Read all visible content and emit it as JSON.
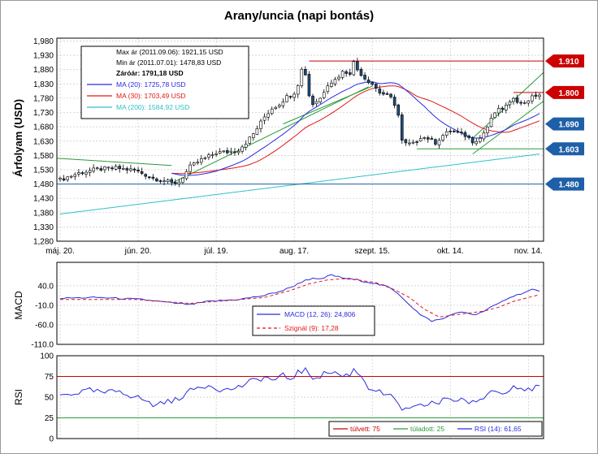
{
  "title": "Arany/uncia (napi bontás)",
  "colors": {
    "up_candle": "#ffffff",
    "down_candle": "#1f4e79",
    "candle_outline": "#000000",
    "ma20": "#2a2ae0",
    "ma30": "#e01818",
    "ma200": "#2cc0c8",
    "trend": "#2a9a3a",
    "level_red": "#cc0000",
    "level_blue": "#1f5fa8",
    "macd": "#2a2ae0",
    "signal": "#e01818",
    "rsi": "#2a2ae0",
    "overbought": "#cc0000",
    "oversold": "#2a9a3a",
    "grid": "#c8c8c8"
  },
  "legend": {
    "max": "Max ár (2011.09.06): 1921,15 USD",
    "min": "Min ár (2011.07.01): 1478,83 USD",
    "close": "Záróár: 1791,18 USD",
    "ma20": "MA (20): 1725,78 USD",
    "ma30": "MA (30): 1703,49 USD",
    "ma200": "MA (200): 1584,92 USD"
  },
  "macd_legend": {
    "macd": "MACD (12, 26): 24,806",
    "signal": "Szignál (9): 17,28"
  },
  "rsi_legend": {
    "overbought": "túlvett: 75",
    "oversold": "túladott: 25",
    "rsi": "RSI (14): 61,65"
  },
  "chart_data": [
    {
      "type": "candlestick",
      "title": "Arany/uncia (napi bontás)",
      "ylabel": "Árfolyam (USD)",
      "ylim": [
        1280,
        1990
      ],
      "yticks": [
        "1,980",
        "1,930",
        "1,880",
        "1,830",
        "1,780",
        "1,730",
        "1,680",
        "1,630",
        "1,580",
        "1,530",
        "1,480",
        "1,430",
        "1,380",
        "1,330",
        "1,280"
      ],
      "x_tick_labels": [
        "máj. 20.",
        "jún. 20.",
        "júl. 19.",
        "aug. 17.",
        "szept. 15.",
        "okt. 14.",
        "nov. 14."
      ],
      "x_tick_index": [
        0,
        21,
        42,
        63,
        84,
        105,
        126
      ],
      "n_days": 130,
      "anchors": [
        [
          0,
          1495
        ],
        [
          5,
          1518
        ],
        [
          10,
          1532
        ],
        [
          15,
          1536
        ],
        [
          20,
          1528
        ],
        [
          22,
          1518
        ],
        [
          25,
          1500
        ],
        [
          28,
          1492
        ],
        [
          30,
          1483
        ],
        [
          32,
          1488
        ],
        [
          35,
          1540
        ],
        [
          38,
          1565
        ],
        [
          40,
          1576
        ],
        [
          42,
          1590
        ],
        [
          45,
          1592
        ],
        [
          48,
          1600
        ],
        [
          50,
          1625
        ],
        [
          52,
          1655
        ],
        [
          55,
          1715
        ],
        [
          57,
          1745
        ],
        [
          59,
          1760
        ],
        [
          61,
          1785
        ],
        [
          63,
          1800
        ],
        [
          64,
          1830
        ],
        [
          65,
          1880
        ],
        [
          66,
          1865
        ],
        [
          67,
          1790
        ],
        [
          68,
          1760
        ],
        [
          70,
          1780
        ],
        [
          72,
          1830
        ],
        [
          74,
          1845
        ],
        [
          76,
          1872
        ],
        [
          78,
          1870
        ],
        [
          79,
          1905
        ],
        [
          80,
          1880
        ],
        [
          82,
          1850
        ],
        [
          84,
          1830
        ],
        [
          86,
          1800
        ],
        [
          88,
          1790
        ],
        [
          89,
          1780
        ],
        [
          90,
          1760
        ],
        [
          91,
          1720
        ],
        [
          92,
          1630
        ],
        [
          93,
          1620
        ],
        [
          95,
          1620
        ],
        [
          97,
          1645
        ],
        [
          99,
          1640
        ],
        [
          101,
          1625
        ],
        [
          103,
          1650
        ],
        [
          105,
          1665
        ],
        [
          107,
          1660
        ],
        [
          109,
          1650
        ],
        [
          111,
          1630
        ],
        [
          113,
          1640
        ],
        [
          115,
          1680
        ],
        [
          117,
          1730
        ],
        [
          119,
          1745
        ],
        [
          121,
          1760
        ],
        [
          122,
          1785
        ],
        [
          124,
          1760
        ],
        [
          126,
          1775
        ],
        [
          128,
          1790
        ],
        [
          129,
          1791.18
        ]
      ],
      "max_price": 1921.15,
      "min_price": 1478.83,
      "close": 1791.18,
      "price_levels": [
        1910,
        1800,
        1690,
        1603,
        1480
      ],
      "price_level_labels": [
        "1.910",
        "1.800",
        "1.690",
        "1.603",
        "1.480"
      ],
      "price_level_colors": [
        "red",
        "red",
        "blue",
        "blue",
        "blue"
      ],
      "ma200_start_end": [
        1375,
        1585
      ],
      "series": [
        {
          "name": "MA (20)",
          "last": 1725.78
        },
        {
          "name": "MA (30)",
          "last": 1703.49
        },
        {
          "name": "MA (200)",
          "last": 1584.92
        }
      ]
    },
    {
      "type": "line",
      "ylabel": "MACD",
      "ylim": [
        -110,
        100
      ],
      "yticks": [
        "40.0",
        "-10.0",
        "-60.0",
        "-110.0"
      ],
      "ytick_values": [
        40,
        -10,
        -60,
        -110
      ],
      "anchors_macd": [
        [
          0,
          8
        ],
        [
          10,
          10
        ],
        [
          22,
          5
        ],
        [
          30,
          -4
        ],
        [
          35,
          -8
        ],
        [
          40,
          0
        ],
        [
          48,
          5
        ],
        [
          55,
          15
        ],
        [
          60,
          28
        ],
        [
          63,
          40
        ],
        [
          66,
          55
        ],
        [
          68,
          58
        ],
        [
          70,
          56
        ],
        [
          73,
          68
        ],
        [
          76,
          60
        ],
        [
          80,
          55
        ],
        [
          85,
          45
        ],
        [
          88,
          38
        ],
        [
          91,
          20
        ],
        [
          94,
          -8
        ],
        [
          97,
          -35
        ],
        [
          100,
          -50
        ],
        [
          103,
          -45
        ],
        [
          106,
          -30
        ],
        [
          109,
          -28
        ],
        [
          112,
          -35
        ],
        [
          115,
          -20
        ],
        [
          118,
          -5
        ],
        [
          121,
          10
        ],
        [
          124,
          20
        ],
        [
          127,
          30
        ],
        [
          129,
          24.8
        ]
      ],
      "anchors_signal": [
        [
          0,
          5
        ],
        [
          20,
          5
        ],
        [
          35,
          -5
        ],
        [
          45,
          2
        ],
        [
          55,
          10
        ],
        [
          62,
          28
        ],
        [
          67,
          45
        ],
        [
          72,
          55
        ],
        [
          76,
          58
        ],
        [
          80,
          55
        ],
        [
          85,
          48
        ],
        [
          90,
          30
        ],
        [
          94,
          10
        ],
        [
          98,
          -20
        ],
        [
          102,
          -40
        ],
        [
          106,
          -35
        ],
        [
          110,
          -30
        ],
        [
          114,
          -25
        ],
        [
          118,
          -15
        ],
        [
          122,
          0
        ],
        [
          126,
          10
        ],
        [
          129,
          17.28
        ]
      ],
      "series": [
        {
          "name": "MACD (12, 26)",
          "last": 24.806
        },
        {
          "name": "Szignál (9)",
          "last": 17.28
        }
      ]
    },
    {
      "type": "line",
      "ylabel": "RSI",
      "ylim": [
        0,
        100
      ],
      "yticks": [
        "100",
        "75",
        "50",
        "25",
        "0"
      ],
      "ytick_values": [
        100,
        75,
        50,
        25,
        0
      ],
      "anchors_rsi": [
        [
          0,
          52
        ],
        [
          4,
          55
        ],
        [
          8,
          58
        ],
        [
          12,
          55
        ],
        [
          16,
          58
        ],
        [
          19,
          52
        ],
        [
          22,
          48
        ],
        [
          25,
          40
        ],
        [
          28,
          45
        ],
        [
          30,
          44
        ],
        [
          33,
          52
        ],
        [
          36,
          60
        ],
        [
          40,
          65
        ],
        [
          44,
          58
        ],
        [
          48,
          62
        ],
        [
          52,
          70
        ],
        [
          55,
          74
        ],
        [
          58,
          70
        ],
        [
          60,
          76
        ],
        [
          62,
          72
        ],
        [
          64,
          80
        ],
        [
          66,
          82
        ],
        [
          68,
          74
        ],
        [
          70,
          76
        ],
        [
          72,
          80
        ],
        [
          74,
          80
        ],
        [
          76,
          75
        ],
        [
          78,
          78
        ],
        [
          79,
          83
        ],
        [
          81,
          76
        ],
        [
          83,
          62
        ],
        [
          85,
          58
        ],
        [
          87,
          54
        ],
        [
          89,
          50
        ],
        [
          91,
          42
        ],
        [
          92,
          36
        ],
        [
          94,
          34
        ],
        [
          96,
          38
        ],
        [
          98,
          40
        ],
        [
          100,
          44
        ],
        [
          102,
          42
        ],
        [
          104,
          50
        ],
        [
          106,
          46
        ],
        [
          108,
          48
        ],
        [
          110,
          44
        ],
        [
          112,
          42
        ],
        [
          114,
          50
        ],
        [
          116,
          58
        ],
        [
          118,
          56
        ],
        [
          120,
          58
        ],
        [
          122,
          64
        ],
        [
          124,
          62
        ],
        [
          126,
          58
        ],
        [
          128,
          62
        ],
        [
          129,
          61.65
        ]
      ],
      "overbought": 75,
      "oversold": 25,
      "series": [
        {
          "name": "RSI (14)",
          "last": 61.65
        }
      ]
    }
  ]
}
